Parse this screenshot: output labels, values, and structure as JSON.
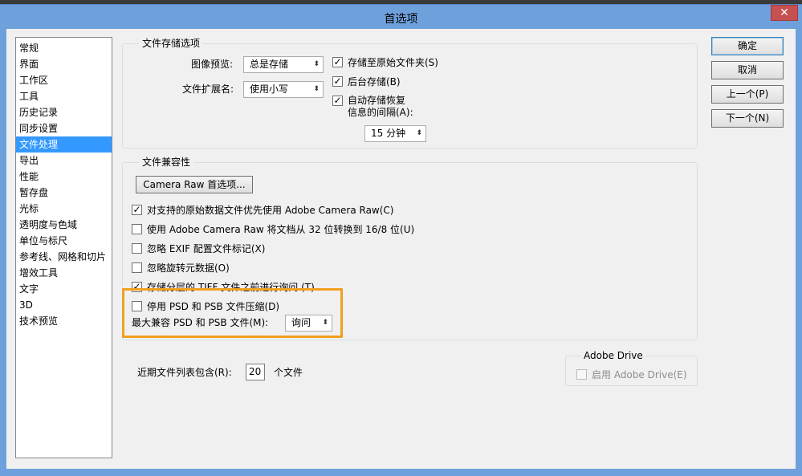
{
  "window": {
    "title": "首选项",
    "close_glyph": "✕"
  },
  "sidebar": {
    "items": [
      {
        "label": "常规",
        "selected": false
      },
      {
        "label": "界面",
        "selected": false
      },
      {
        "label": "工作区",
        "selected": false
      },
      {
        "label": "工具",
        "selected": false
      },
      {
        "label": "历史记录",
        "selected": false
      },
      {
        "label": "同步设置",
        "selected": false
      },
      {
        "label": "文件处理",
        "selected": true
      },
      {
        "label": "导出",
        "selected": false
      },
      {
        "label": "性能",
        "selected": false
      },
      {
        "label": "暂存盘",
        "selected": false
      },
      {
        "label": "光标",
        "selected": false
      },
      {
        "label": "透明度与色域",
        "selected": false
      },
      {
        "label": "单位与标尺",
        "selected": false
      },
      {
        "label": "参考线、网格和切片",
        "selected": false
      },
      {
        "label": "增效工具",
        "selected": false
      },
      {
        "label": "文字",
        "selected": false
      },
      {
        "label": "3D",
        "selected": false
      },
      {
        "label": "技术预览",
        "selected": false
      }
    ]
  },
  "file_save": {
    "title": "文件存储选项",
    "preview_label": "图像预览:",
    "preview_value": "总是存储",
    "ext_label": "文件扩展名:",
    "ext_value": "使用小写",
    "save_original_label": "存储至原始文件夹(S)",
    "save_original_checked": true,
    "background_save_label": "后台存储(B)",
    "background_save_checked": true,
    "autosave_label_line1": "自动存储恢复",
    "autosave_label_line2": "信息的间隔(A):",
    "autosave_checked": true,
    "interval_value": "15 分钟"
  },
  "compat": {
    "title": "文件兼容性",
    "camera_raw_button": "Camera Raw 首选项...",
    "options": [
      {
        "label": "对支持的原始数据文件优先使用 Adobe Camera Raw(C)",
        "checked": true
      },
      {
        "label": "使用 Adobe Camera Raw 将文档从 32 位转换到 16/8 位(U)",
        "checked": false
      },
      {
        "label": "忽略 EXIF 配置文件标记(X)",
        "checked": false
      },
      {
        "label": "忽略旋转元数据(O)",
        "checked": false
      },
      {
        "label": "存储分层的 TIFF 文件之前进行询问 (T)",
        "checked": true
      },
      {
        "label": "停用 PSD 和 PSB 文件压缩(D)",
        "checked": false
      }
    ],
    "max_compat_label": "最大兼容 PSD 和 PSB 文件(M):",
    "max_compat_value": "询问"
  },
  "recent": {
    "label": "近期文件列表包含(R):",
    "value": "20",
    "suffix": "个文件"
  },
  "adobe_drive": {
    "title": "Adobe Drive",
    "enable_label": "启用 Adobe Drive(E)",
    "checked": false,
    "enabled": false
  },
  "buttons": {
    "ok": "确定",
    "cancel": "取消",
    "prev": "上一个(P)",
    "next": "下一个(N)"
  },
  "colors": {
    "titlebar": "#6ea0dc",
    "selection": "#3399ff",
    "highlight_box": "#f0a020",
    "close_button": "#c75050"
  },
  "icons": {
    "checkmark": "✓",
    "combo_arrow": "⬍"
  }
}
